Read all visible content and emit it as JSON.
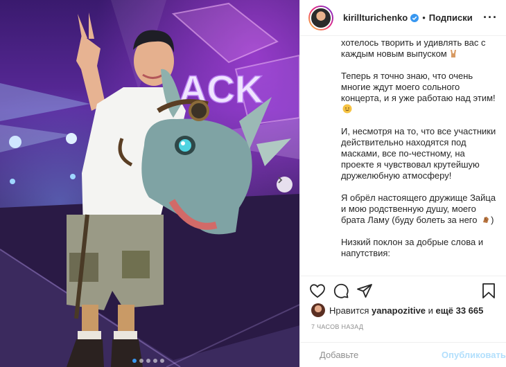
{
  "post": {
    "username": "kirillturichenko",
    "verified": true,
    "separator": "•",
    "follow_label": "Подписки",
    "more_label": "···"
  },
  "caption": {
    "paragraphs": [
      "хотелось творить и удивлять вас с каждым новым выпуском",
      "Теперь я точно знаю, что очень многие ждут моего сольного концерта, и я уже работаю над этим!",
      "И, несмотря на то, что все участники действительно находятся под масками, все по-честному, на проекте я чувствовал крутейшую дружелюбную атмосферу!",
      "Я обрёл настоящего дружище Зайца и мою родственную душу, моего брата Ламу (буду болеть за него",
      "Низкий поклон за добрые слова и напутствия:"
    ],
    "paragraph4_tail": ")"
  },
  "likes": {
    "prefix": "Нравится",
    "user": "yanapozitive",
    "middle": "и",
    "count": "ещё 33 665"
  },
  "timestamp": "7 ЧАСОВ НАЗАД",
  "comment": {
    "placeholder": "Добавьте",
    "publish_label": "Опубликовать"
  },
  "photo": {
    "sign_text": "ACK",
    "carousel_dots": 5,
    "active_dot": 0
  },
  "colors": {
    "accent": "#3897f0",
    "publish_disabled": "#b2dffc",
    "secondary_text": "#8e8e8e"
  }
}
